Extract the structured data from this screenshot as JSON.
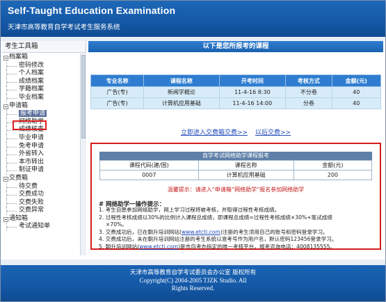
{
  "header": {
    "title": "Self-Taught Education Examination",
    "subtitle": "天津市高等教育自学考试考生服务系统"
  },
  "sidebar": {
    "title": "考生工具箱",
    "groups": [
      {
        "label": "档案箱",
        "items": [
          "密码修改",
          "个人档案",
          "成绩档案",
          "学籍档案",
          "毕业档案"
        ]
      },
      {
        "label": "申请箱",
        "items": [
          "报考申请",
          "网络助学",
          "成绩核查",
          "毕业申请",
          "免考申请",
          "外省转入",
          "本市转出",
          "制证申请"
        ]
      },
      {
        "label": "交费箱",
        "items": [
          "待交费",
          "交费成功",
          "交费失败",
          "交费异常"
        ]
      },
      {
        "label": "通知箱",
        "items": [
          "考试通知单"
        ]
      }
    ],
    "selected_item": "报考申请"
  },
  "main": {
    "title": "以下是您所报考的课程",
    "table": {
      "headers": [
        "专业名称",
        "课程名称",
        "开考时间",
        "考核方式",
        "金额(元)"
      ],
      "rows": [
        [
          "广告(专)",
          "新闻学概论",
          "11-4-16 8:30",
          "不分卷",
          "40"
        ],
        [
          "广告(专)",
          "计算机应用基础",
          "11-4-16 14:00",
          "分卷",
          "40"
        ]
      ]
    },
    "links": {
      "pay_now": "立即进入交费箱交费>>",
      "pay_later": "以后交费>>"
    },
    "notice": {
      "title": "自学考试网络助学课程报考",
      "headers": [
        "课程代码(建/国)",
        "课程名称",
        "金额(元)"
      ],
      "row": [
        "0007",
        "计算机应用基础",
        "200"
      ],
      "warning": "温馨提示：请进入“申请箱”网络助学”报名参加网络助学",
      "guide_title": "# 网络助学一操作提示：",
      "guide": [
        {
          "pre": "1. 考生自愿参加网络助学，网上学习过程将被考核，并取得过程性考核成绩。",
          "link": "",
          "post": ""
        },
        {
          "pre": "2. 过程性考核成绩以30%的比例计入课程总成绩，即课程总成绩=过程性考核成绩×30%+笔试成绩",
          "link": "",
          "post": ""
        },
        {
          "pre": "×70%。",
          "link": "",
          "post": ""
        },
        {
          "pre": "3. 交费成功后，已在朝升培训网站(",
          "link": "www.etcti.com",
          "post": ")注册的考生须用自己的账号和密码登录学习。"
        },
        {
          "pre": "4. 交费成功后，未在朝升培训网站注册的考生系统以准考号作为用户名，默认密码123456登录学习。",
          "link": "",
          "post": ""
        },
        {
          "pre": "5. 朝升培训网站(",
          "link": "www.etcti.com",
          "post": ")是市自考办指定的唯一考核平台，报考咨询电话：4008135555。"
        }
      ]
    }
  },
  "footer": {
    "line1": "天津市高等教育自学考试委员会办公室 版权所有",
    "line2": "Copyright(C) 2004-2005 TJZK Studio. All",
    "line3": "Rights Reserved."
  }
}
